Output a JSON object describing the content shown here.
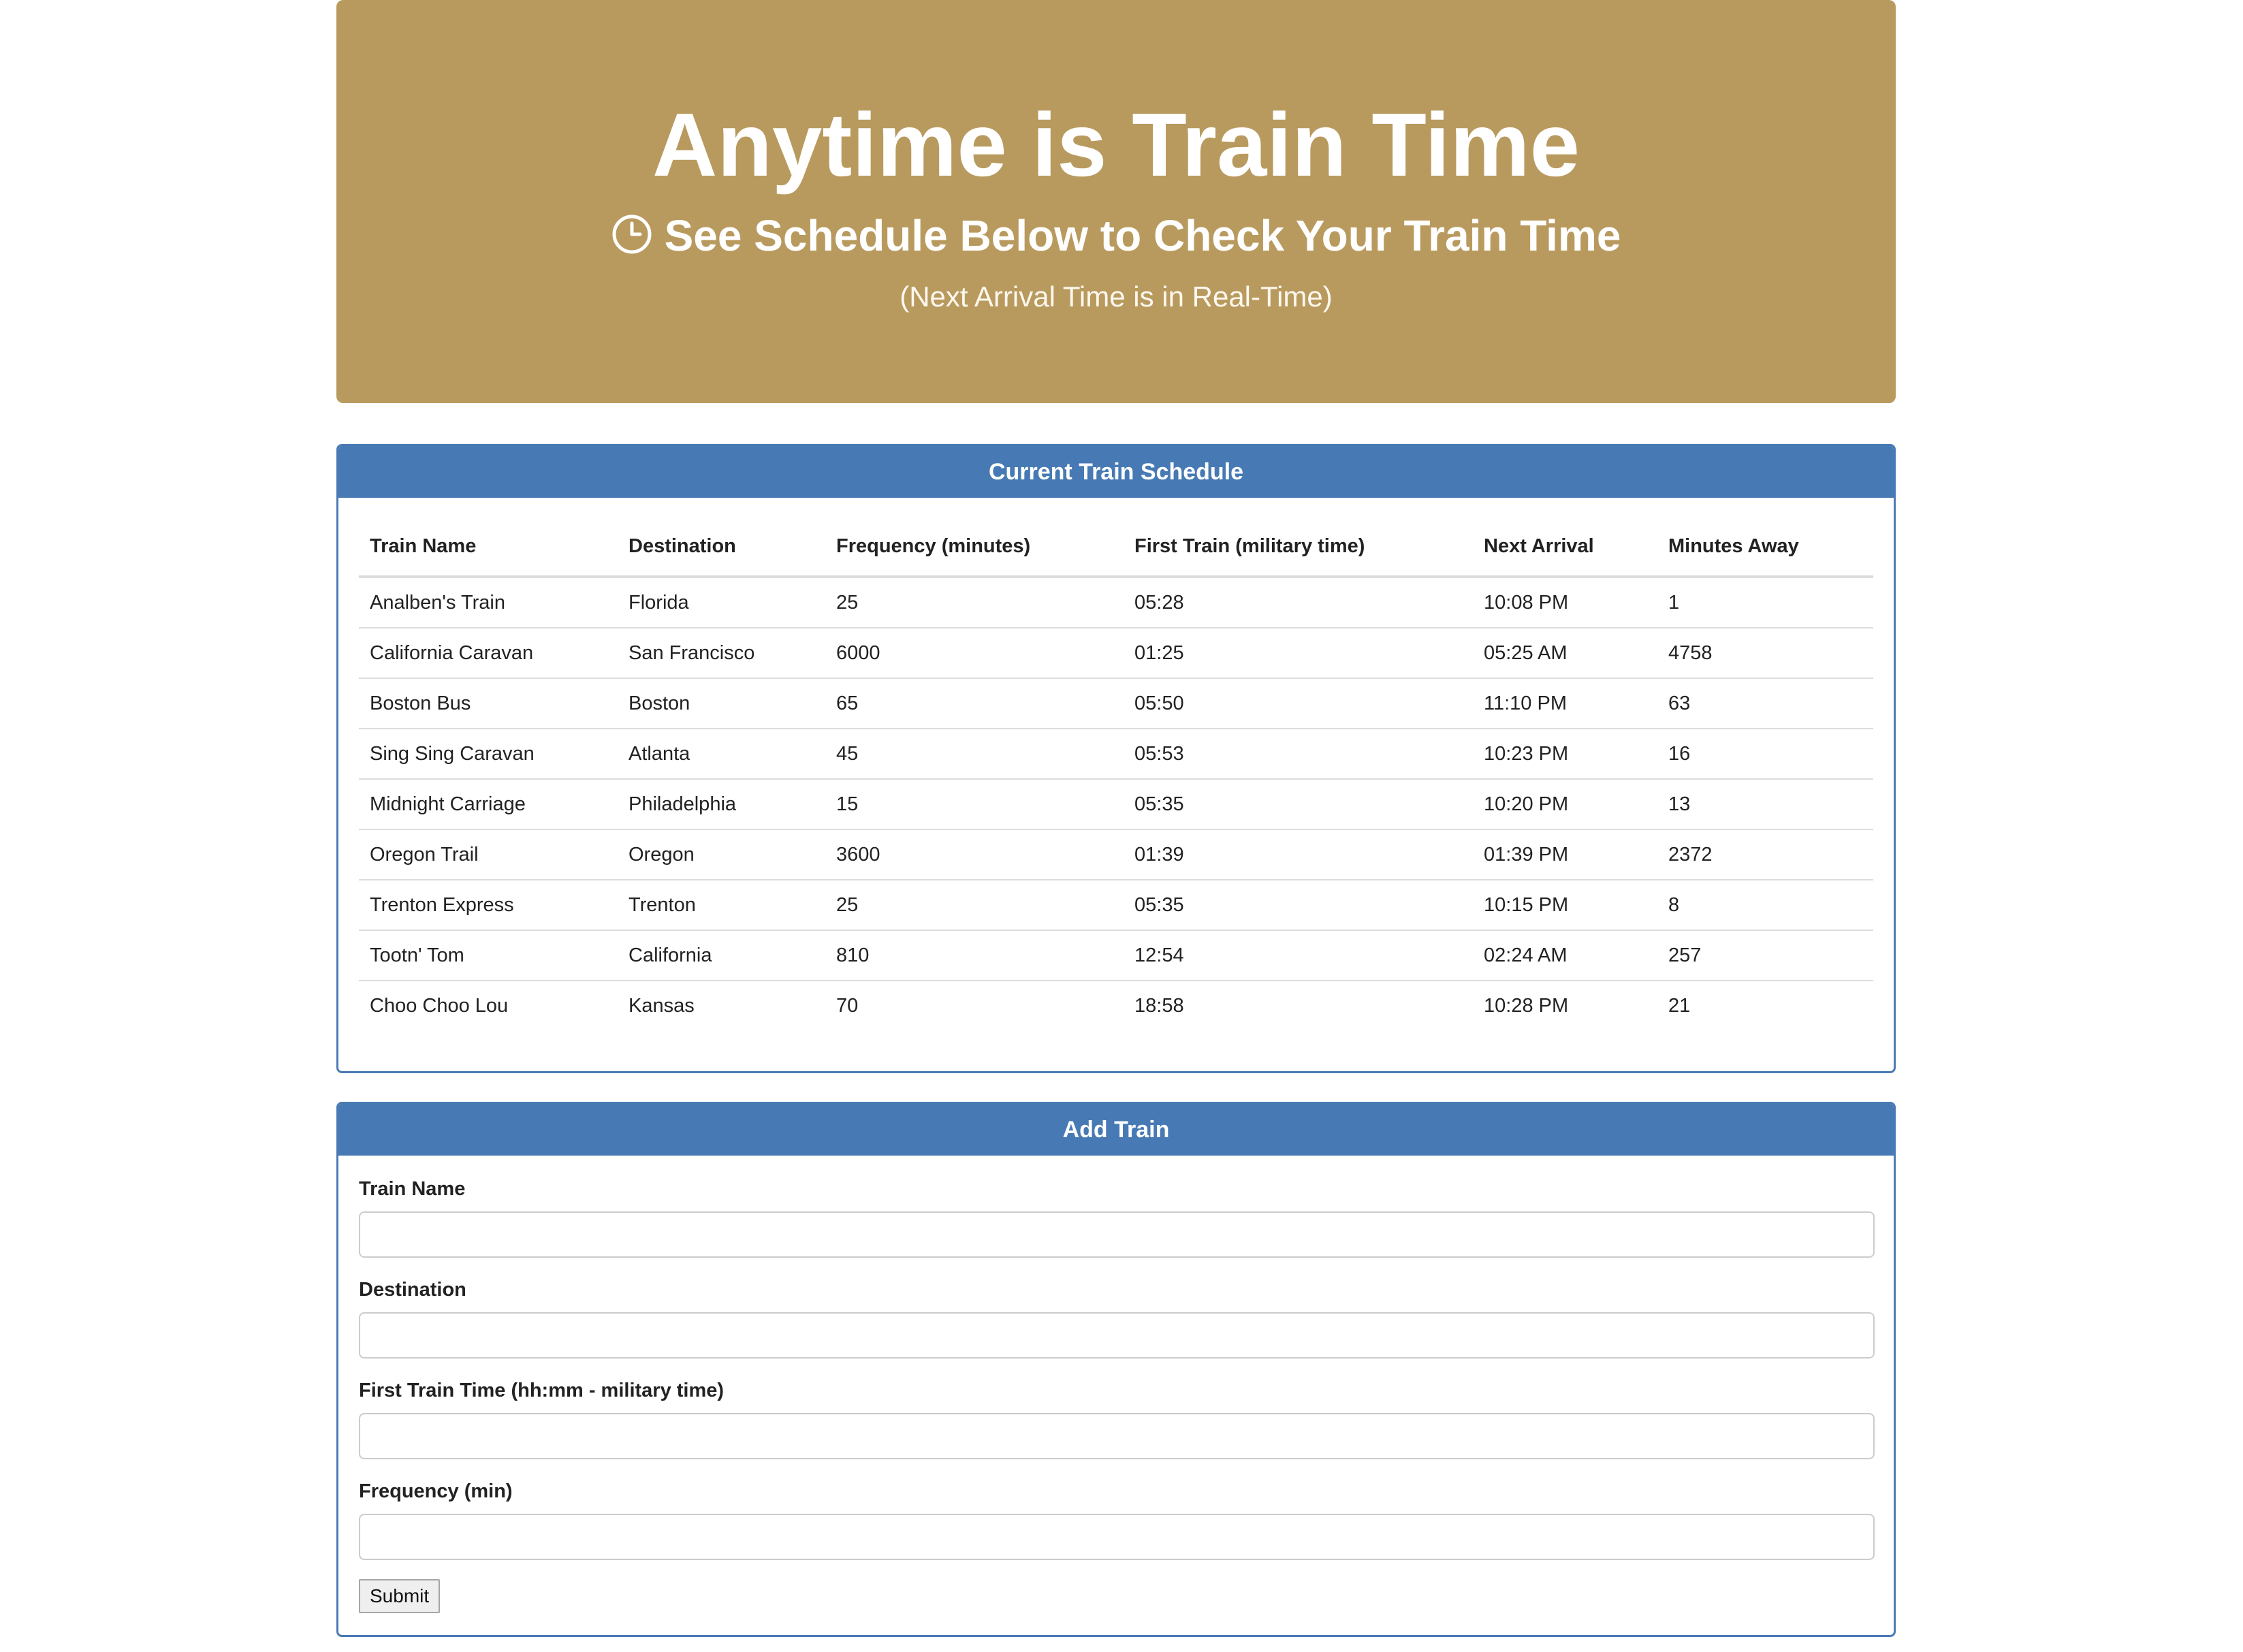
{
  "header": {
    "title": "Anytime is Train Time",
    "subtitle": "See Schedule Below to Check Your Train Time",
    "subtitle_icon": "clock-icon",
    "note": "(Next Arrival Time is in Real-Time)",
    "background_color": "#b99a5e"
  },
  "schedule": {
    "heading": "Current Train Schedule",
    "columns": [
      "Train Name",
      "Destination",
      "Frequency (minutes)",
      "First Train (military time)",
      "Next Arrival",
      "Minutes Away"
    ],
    "rows": [
      [
        "Analben's Train",
        "Florida",
        "25",
        "05:28",
        "10:08 PM",
        "1"
      ],
      [
        "California Caravan",
        "San Francisco",
        "6000",
        "01:25",
        "05:25 AM",
        "4758"
      ],
      [
        "Boston Bus",
        "Boston",
        "65",
        "05:50",
        "11:10 PM",
        "63"
      ],
      [
        "Sing Sing Caravan",
        "Atlanta",
        "45",
        "05:53",
        "10:23 PM",
        "16"
      ],
      [
        "Midnight Carriage",
        "Philadelphia",
        "15",
        "05:35",
        "10:20 PM",
        "13"
      ],
      [
        "Oregon Trail",
        "Oregon",
        "3600",
        "01:39",
        "01:39 PM",
        "2372"
      ],
      [
        "Trenton Express",
        "Trenton",
        "25",
        "05:35",
        "10:15 PM",
        "8"
      ],
      [
        "Tootn' Tom",
        "California",
        "810",
        "12:54",
        "02:24 AM",
        "257"
      ],
      [
        "Choo Choo Lou",
        "Kansas",
        "70",
        "18:58",
        "10:28 PM",
        "21"
      ]
    ]
  },
  "add_train": {
    "heading": "Add Train",
    "fields": [
      {
        "label": "Train Name",
        "value": "",
        "placeholder": ""
      },
      {
        "label": "Destination",
        "value": "",
        "placeholder": ""
      },
      {
        "label": "First Train Time (hh:mm - military time)",
        "value": "",
        "placeholder": ""
      },
      {
        "label": "Frequency (min)",
        "value": "",
        "placeholder": ""
      }
    ],
    "submit_label": "Submit"
  },
  "colors": {
    "panel_accent": "#477ab4"
  }
}
